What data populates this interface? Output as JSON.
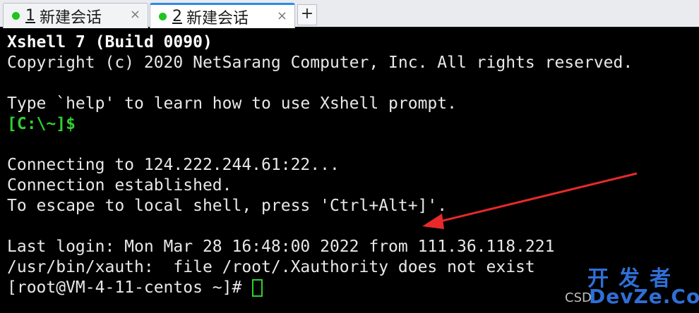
{
  "tabs": [
    {
      "number": "1",
      "title": "新建会话",
      "close": "×",
      "status_color": "#1ec51e",
      "active": false
    },
    {
      "number": "2",
      "title": "新建会话",
      "close": "×",
      "status_color": "#1ec51e",
      "active": true
    }
  ],
  "new_tab_label": "+",
  "terminal": {
    "lines": [
      "Xshell 7 (Build 0090)",
      "Copyright (c) 2020 NetSarang Computer, Inc. All rights reserved.",
      "",
      "Type `help' to learn how to use Xshell prompt.",
      "[C:\\~]$",
      "",
      "Connecting to 124.222.244.61:22...",
      "Connection established.",
      "To escape to local shell, press 'Ctrl+Alt+]'.",
      "",
      "Last login: Mon Mar 28 16:48:00 2022 from 111.36.118.221",
      "/usr/bin/xauth:  file /root/.Xauthority does not exist",
      "[root@VM-4-11-centos ~]# "
    ]
  },
  "watermark": {
    "cn": "开发者",
    "en": "DevZe.CoM",
    "csdn": "CSD"
  },
  "colors": {
    "terminal_bg": "#000000",
    "terminal_fg": "#e8e8e8",
    "prompt_green": "#30d030",
    "arrow_red": "#e8292b",
    "active_tab_accent": "#2f8ae6"
  }
}
